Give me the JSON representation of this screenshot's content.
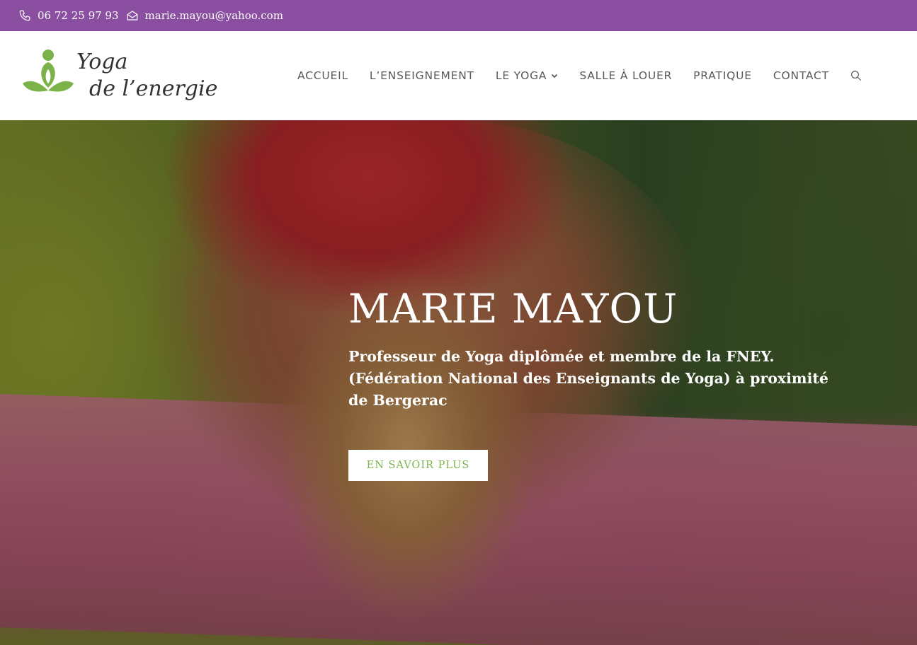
{
  "topbar": {
    "phone": "06 72 25 97 93",
    "email": "marie.mayou@yahoo.com",
    "background": "#8a4fa0"
  },
  "logo": {
    "line1": "Yoga",
    "line2": "de l’energie",
    "accent": "#7bb34a"
  },
  "nav": {
    "items": [
      {
        "label": "ACCUEIL"
      },
      {
        "label": "L’ENSEIGNEMENT"
      },
      {
        "label": "LE YOGA"
      },
      {
        "label": "SALLE À LOUER"
      },
      {
        "label": "PRATIQUE"
      },
      {
        "label": "CONTACT"
      }
    ]
  },
  "hero": {
    "title": "MARIE MAYOU",
    "subtitle_line1": "Professeur de Yoga diplômée et membre de la FNEY.",
    "subtitle_line2": "(Fédération National des Enseignants de Yoga) à proximité de Bergerac",
    "cta_label": "EN SAVOIR PLUS",
    "cta_color": "#7bb34a"
  }
}
